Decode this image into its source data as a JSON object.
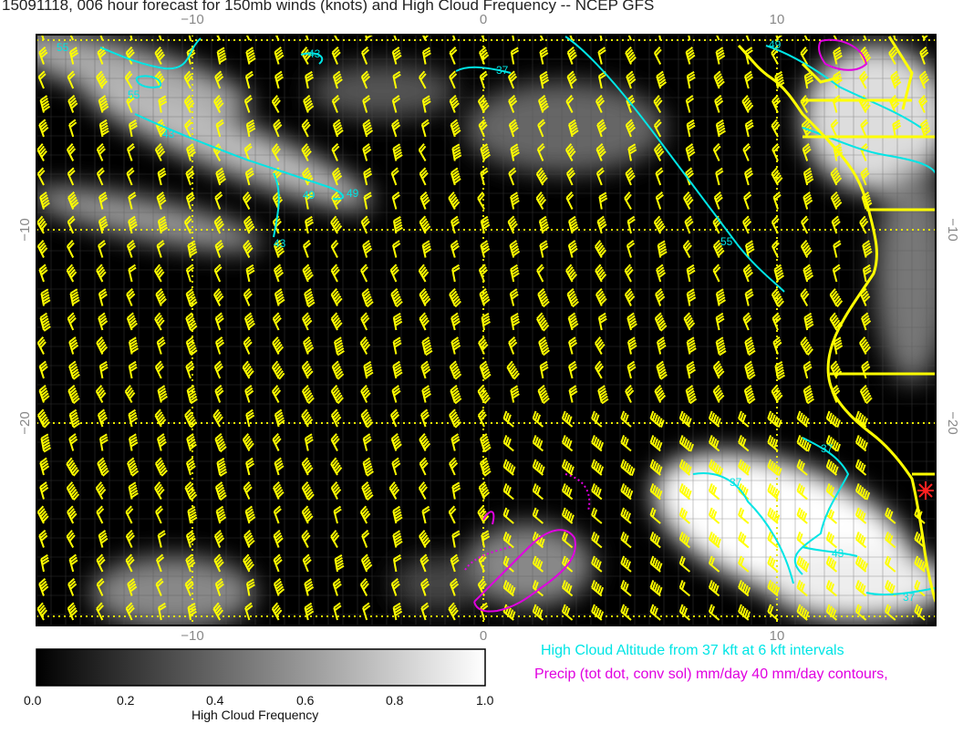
{
  "title": "15091118, 006 hour forecast for 150mb winds (knots) and High Cloud Frequency -- NCEP GFS",
  "axes": {
    "lon_ticks_top": [
      "−10",
      "0",
      "10"
    ],
    "lon_ticks_bottom": [
      "−10",
      "0",
      "10"
    ],
    "lat_ticks_left": [
      "−10",
      "−20"
    ],
    "lat_ticks_right": [
      "−10",
      "−20"
    ]
  },
  "contour_labels": {
    "cyan": [
      "55",
      "55",
      "43",
      "43",
      "49",
      "49",
      "37",
      "55",
      "43",
      "49",
      "37",
      "37",
      "43",
      "37"
    ],
    "magenta": []
  },
  "legend": {
    "altitude": "High Cloud Altitude from 37 kft at 6 kft intervals",
    "precip": "Precip (tot dot, conv sol) mm/day 40 mm/day contours,"
  },
  "colorbar": {
    "title": "High Cloud Frequency",
    "ticks": [
      "0.0",
      "0.2",
      "0.4",
      "0.6",
      "0.8",
      "1.0"
    ]
  },
  "colors": {
    "coast": "#ffff00",
    "barbs": "#ffff00",
    "cloud_altitude": "#00e5e5",
    "precip": "#e000e0",
    "marker": "#ff2020",
    "background": "#000000"
  },
  "chart_data": {
    "type": "heatmap",
    "variable": "High Cloud Frequency",
    "x_range": [
      -15,
      15
    ],
    "y_range": [
      -30,
      0
    ],
    "scale": [
      0.0,
      1.0
    ]
  }
}
